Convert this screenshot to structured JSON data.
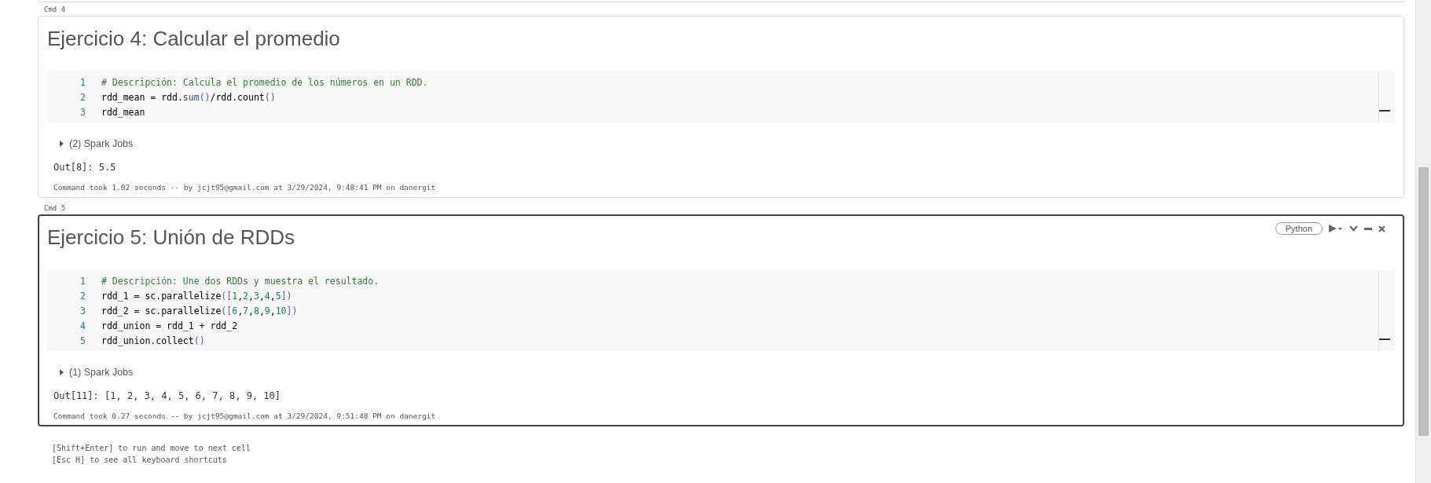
{
  "cells": [
    {
      "cmd": "Cmd 4",
      "selected": false,
      "title": "Ejercicio 4: Calcular el promedio",
      "code": [
        {
          "number": "1",
          "tokens": [
            {
              "kind": "comment",
              "text": "# Descripción: Calcula el promedio de los números en un RDD."
            }
          ]
        },
        {
          "number": "2",
          "tokens": [
            {
              "kind": "plain",
              "text": "rdd_mean = rdd."
            },
            {
              "kind": "builtin",
              "text": "sum"
            },
            {
              "kind": "bracket",
              "text": "()"
            },
            {
              "kind": "plain",
              "text": "/rdd.count"
            },
            {
              "kind": "bracket",
              "text": "()"
            }
          ]
        },
        {
          "number": "3",
          "tokens": [
            {
              "kind": "plain",
              "text": "rdd_mean"
            }
          ]
        }
      ],
      "jobs": {
        "label": "(2) Spark Jobs",
        "expanded": false
      },
      "output": "Out[8]: 5.5",
      "footer": "Command took 1.02 seconds -- by jcjt95@gmail.com at 3/29/2024, 9:48:41 PM on danergit"
    },
    {
      "cmd": "Cmd 5",
      "selected": true,
      "language": "Python",
      "title": "Ejercicio 5: Unión de RDDs",
      "code": [
        {
          "number": "1",
          "tokens": [
            {
              "kind": "comment",
              "text": "# Descripción: Une dos RDDs y muestra el resultado."
            }
          ]
        },
        {
          "number": "2",
          "tokens": [
            {
              "kind": "plain",
              "text": "rdd_1 = sc.parallelize"
            },
            {
              "kind": "bracket",
              "text": "(["
            },
            {
              "kind": "number",
              "text": "1"
            },
            {
              "kind": "plain",
              "text": ","
            },
            {
              "kind": "number",
              "text": "2"
            },
            {
              "kind": "plain",
              "text": ","
            },
            {
              "kind": "number",
              "text": "3"
            },
            {
              "kind": "plain",
              "text": ","
            },
            {
              "kind": "number",
              "text": "4"
            },
            {
              "kind": "plain",
              "text": ","
            },
            {
              "kind": "number",
              "text": "5"
            },
            {
              "kind": "bracket",
              "text": "])"
            }
          ]
        },
        {
          "number": "3",
          "tokens": [
            {
              "kind": "plain",
              "text": "rdd_2 = sc.parallelize"
            },
            {
              "kind": "bracket",
              "text": "(["
            },
            {
              "kind": "number",
              "text": "6"
            },
            {
              "kind": "plain",
              "text": ","
            },
            {
              "kind": "number",
              "text": "7"
            },
            {
              "kind": "plain",
              "text": ","
            },
            {
              "kind": "number",
              "text": "8"
            },
            {
              "kind": "plain",
              "text": ","
            },
            {
              "kind": "number",
              "text": "9"
            },
            {
              "kind": "plain",
              "text": ","
            },
            {
              "kind": "number",
              "text": "10"
            },
            {
              "kind": "bracket",
              "text": "])"
            }
          ]
        },
        {
          "number": "4",
          "tokens": [
            {
              "kind": "plain",
              "text": "rdd_union = rdd_1 + rdd_2"
            }
          ]
        },
        {
          "number": "5",
          "tokens": [
            {
              "kind": "plain",
              "text": "rdd_union.collect"
            },
            {
              "kind": "bracket",
              "text": "()"
            }
          ]
        }
      ],
      "jobs": {
        "label": "(1) Spark Jobs",
        "expanded": false
      },
      "output": "Out[11]: [1, 2, 3, 4, 5, 6, 7, 8, 9, 10]",
      "footer": "Command took 0.27 seconds -- by jcjt95@gmail.com at 3/29/2024, 9:51:48 PM on danergit"
    }
  ],
  "hints": [
    "[Shift+Enter] to run and move to next cell",
    "[Esc H] to see all keyboard shortcuts"
  ]
}
